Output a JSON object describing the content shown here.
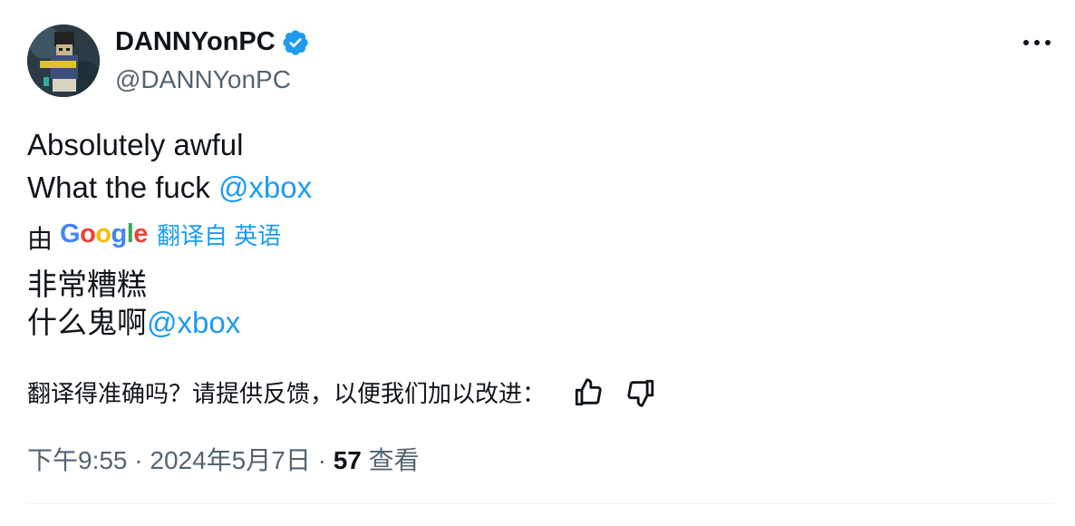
{
  "author": {
    "display_name": "DANNYonPC",
    "handle": "@DANNYonPC",
    "verified": true
  },
  "tweet": {
    "line1": "Absolutely awful",
    "line2_text": "What the fuck ",
    "line2_mention": "@xbox"
  },
  "translation": {
    "by_label": "由",
    "provider_letters": [
      "G",
      "o",
      "o",
      "g",
      "l",
      "e"
    ],
    "translated_from": "翻译自 英语",
    "line1": "非常糟糕",
    "line2_text": "什么鬼啊",
    "line2_mention": "@xbox"
  },
  "feedback": {
    "prompt": "翻译得准确吗？请提供反馈，以便我们加以改进：",
    "thumbs_up_icon": "thumbs-up-icon",
    "thumbs_down_icon": "thumbs-down-icon"
  },
  "meta": {
    "time": "下午9:55",
    "separator": " · ",
    "date": "2024年5月7日",
    "views_count": "57",
    "views_label": " 查看"
  },
  "colors": {
    "link": "#1d9bf0",
    "text": "#0f1419",
    "muted": "#536471",
    "verified": "#1d9bf0"
  }
}
